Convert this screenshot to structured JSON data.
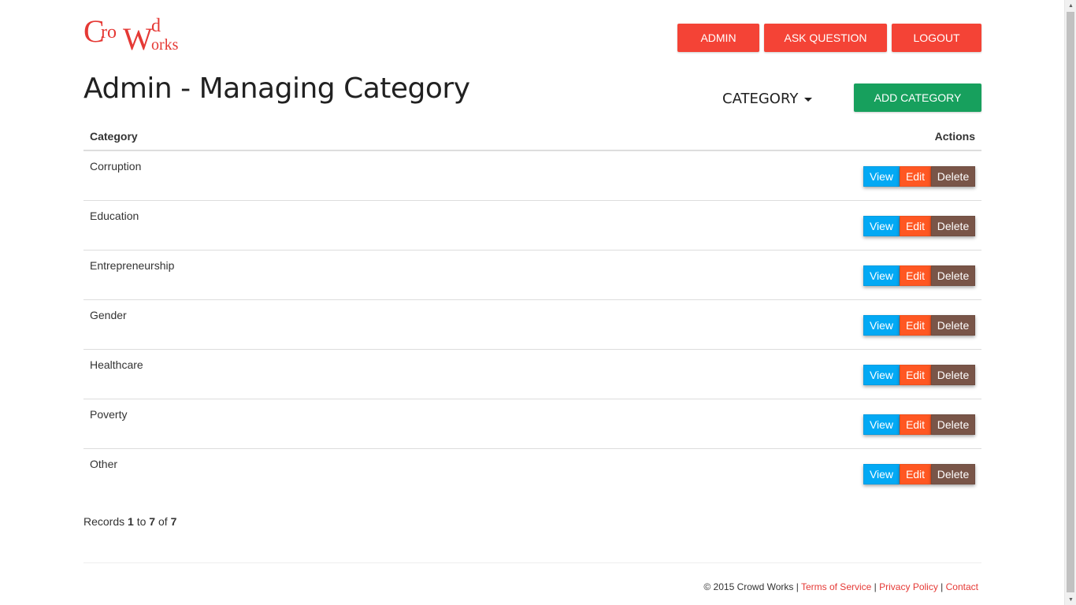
{
  "logo": {
    "c": "C",
    "ro": "ro",
    "w": "W",
    "d": "d",
    "orks": "orks"
  },
  "nav": {
    "admin": "ADMIN",
    "ask": "ASK QUESTION",
    "logout": "LOGOUT"
  },
  "page_title": "Admin - Managing Category",
  "category_dropdown": "CATEGORY",
  "add_button": "ADD CATEGORY",
  "table": {
    "headers": {
      "category": "Category",
      "actions": "Actions"
    },
    "rows": [
      {
        "name": "Corruption"
      },
      {
        "name": "Education"
      },
      {
        "name": "Entrepreneurship"
      },
      {
        "name": "Gender"
      },
      {
        "name": "Healthcare"
      },
      {
        "name": "Poverty"
      },
      {
        "name": "Other"
      }
    ],
    "action_labels": {
      "view": "View",
      "edit": "Edit",
      "delete": "Delete"
    }
  },
  "records": {
    "prefix": "Records",
    "from": "1",
    "to_word": "to",
    "to": "7",
    "of_word": "of",
    "total": "7"
  },
  "footer": {
    "copyright": "© 2015 Crowd Works",
    "sep": "|",
    "terms": "Terms of Service",
    "privacy": "Privacy Policy",
    "contact": "Contact"
  },
  "colors": {
    "red": "#f44336",
    "green": "#17a05d",
    "view": "#03a9f4",
    "edit": "#ff5722",
    "delete": "#795548"
  }
}
